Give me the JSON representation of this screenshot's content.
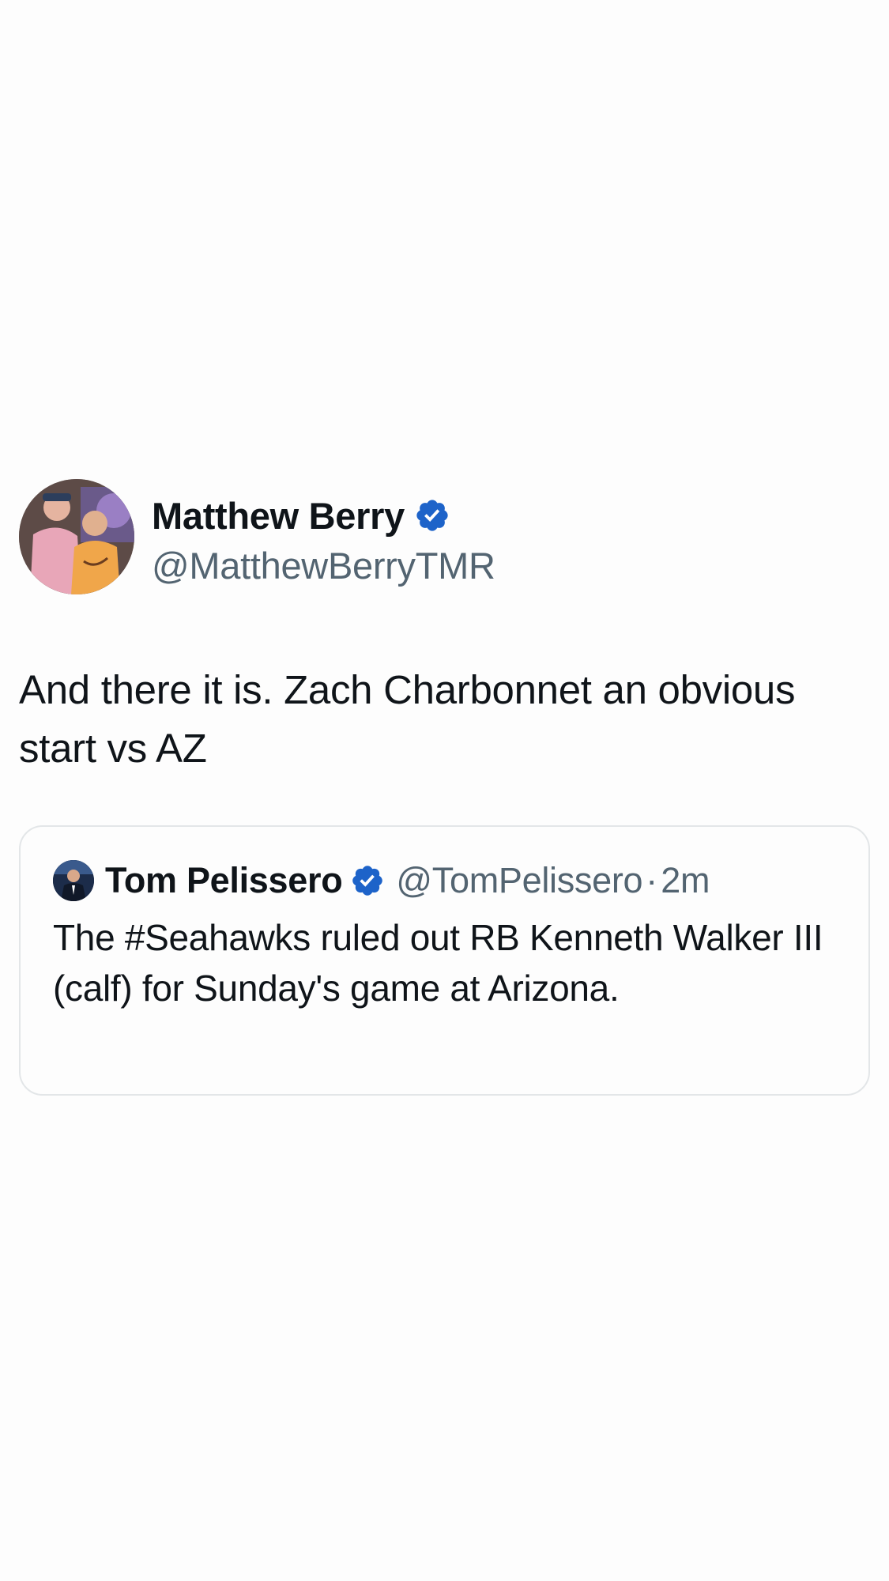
{
  "tweet": {
    "author": {
      "display_name": "Matthew Berry",
      "handle": "@MatthewBerryTMR",
      "verified": true,
      "avatar_icon": "profile-photo"
    },
    "text": "And there it is. Zach Charbonnet an obvious start vs AZ"
  },
  "quoted_tweet": {
    "author": {
      "display_name": "Tom Pelissero",
      "handle": "@TomPelissero",
      "verified": true,
      "avatar_icon": "profile-photo"
    },
    "separator": "·",
    "time": "2m",
    "text": "The #Seahawks ruled out RB Kenneth Walker III (calf) for Sunday's game at Arizona."
  },
  "colors": {
    "background": "#fdfdfd",
    "text_primary": "#0f1419",
    "text_secondary": "#536471",
    "verified_badge": "#1d63c9",
    "card_border": "#e3e6e8"
  }
}
